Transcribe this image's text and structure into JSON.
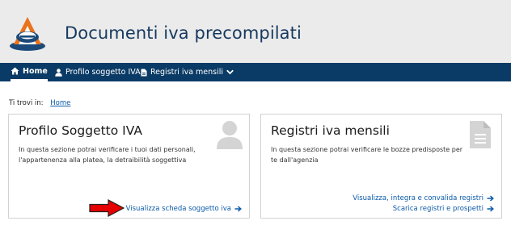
{
  "app": {
    "title": "Documenti iva precompilati"
  },
  "nav": {
    "items": [
      {
        "label": "Home",
        "icon": "home-icon",
        "active": true
      },
      {
        "label": "Profilo soggetto IVA",
        "icon": "user-icon",
        "active": false
      },
      {
        "label": "Registri iva mensili",
        "icon": "document-icon",
        "active": false,
        "dropdown": true
      }
    ]
  },
  "breadcrumb": {
    "prefix": "Ti trovi in:",
    "items": [
      "Home"
    ]
  },
  "cards": [
    {
      "title": "Profilo Soggetto IVA",
      "description": "In questa sezione potrai verificare i tuoi dati personali, l'appartenenza alla platea, la detraibilità soggettiva",
      "icon": "user-silhouette-icon",
      "links": [
        {
          "label": "Visualizza scheda soggetto iva"
        }
      ]
    },
    {
      "title": "Registri iva mensili",
      "description": "In questa sezione potrai verificare le bozze predisposte per te dall'agenzia",
      "icon": "document-icon",
      "links": [
        {
          "label": "Visualizza, integra e convalida registri"
        },
        {
          "label": "Scarica registri e prospetti"
        }
      ]
    }
  ],
  "colors": {
    "brand": "#0a3b66",
    "link": "#0a5aa8",
    "annotation_arrow": "#e60000"
  }
}
